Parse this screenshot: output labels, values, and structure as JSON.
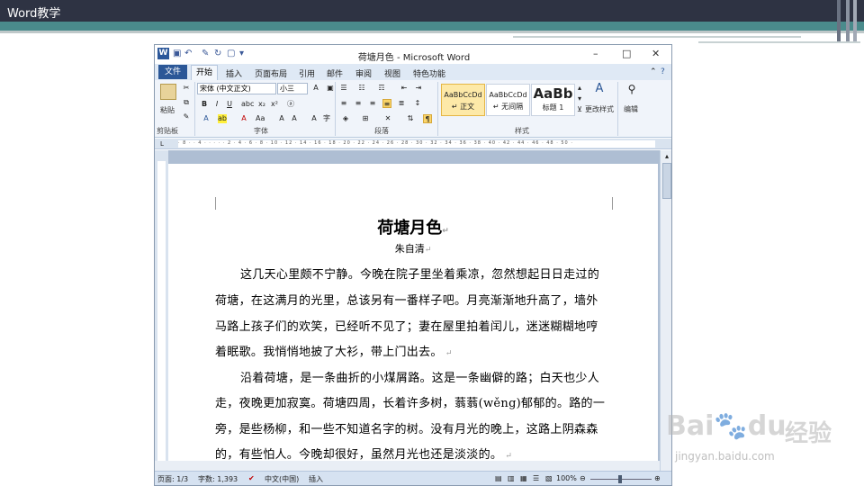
{
  "slide": {
    "title": "Word教学"
  },
  "window": {
    "title": "荷塘月色 - Microsoft Word",
    "logo_text": "W",
    "controls": {
      "minimize": "–",
      "maximize": "□",
      "close": "✕"
    }
  },
  "tabs": {
    "file": "文件",
    "home": "开始",
    "items": [
      "插入",
      "页面布局",
      "引用",
      "邮件",
      "审阅",
      "视图",
      "特色功能"
    ]
  },
  "ribbon": {
    "clipboard": {
      "paste": "粘贴",
      "label": "剪贴板"
    },
    "font": {
      "name": "宋体 (中文正文)",
      "size": "小三",
      "label": "字体",
      "bold": "B",
      "italic": "I",
      "underline": "U"
    },
    "paragraph": {
      "label": "段落"
    },
    "styles": {
      "label": "样式",
      "items": [
        {
          "preview": "AaBbCcDd",
          "name": "↵ 正文"
        },
        {
          "preview": "AaBbCcDd",
          "name": "↵ 无间隔"
        },
        {
          "preview": "AaBb",
          "name": "标题 1"
        }
      ],
      "change": "更改样式"
    },
    "editing": {
      "label": "编辑"
    }
  },
  "document": {
    "title": "荷塘月色",
    "author": "朱自清",
    "lines": [
      "这几天心里颇不宁静。今晚在院子里坐着乘凉，忽然想起日日走过的",
      "荷塘，在这满月的光里，总该另有一番样子吧。月亮渐渐地升高了，墙外",
      "马路上孩子们的欢笑，已经听不见了；妻在屋里拍着闰儿，迷迷糊糊地哼",
      "着眠歌。我悄悄地披了大衫，带上门出去。",
      "沿着荷塘，是一条曲折的小煤屑路。这是一条幽僻的路；白天也少人",
      "走，夜晚更加寂寞。荷塘四周，长着许多树，蓊蓊(wěng)郁郁的。路的一",
      "旁，是些杨柳，和一些不知道名字的树。没有月光的晚上，这路上阴森森",
      "的，有些怕人。今晚却很好，虽然月光也还是淡淡的。"
    ]
  },
  "status": {
    "page": "页面: 1/3",
    "words": "字数: 1,393",
    "lang": "中文(中国)",
    "mode": "插入",
    "zoom": "100%"
  },
  "watermark": {
    "brand": "Bai",
    "brand2": "du",
    "text": "经验",
    "url": "jingyan.baidu.com"
  }
}
